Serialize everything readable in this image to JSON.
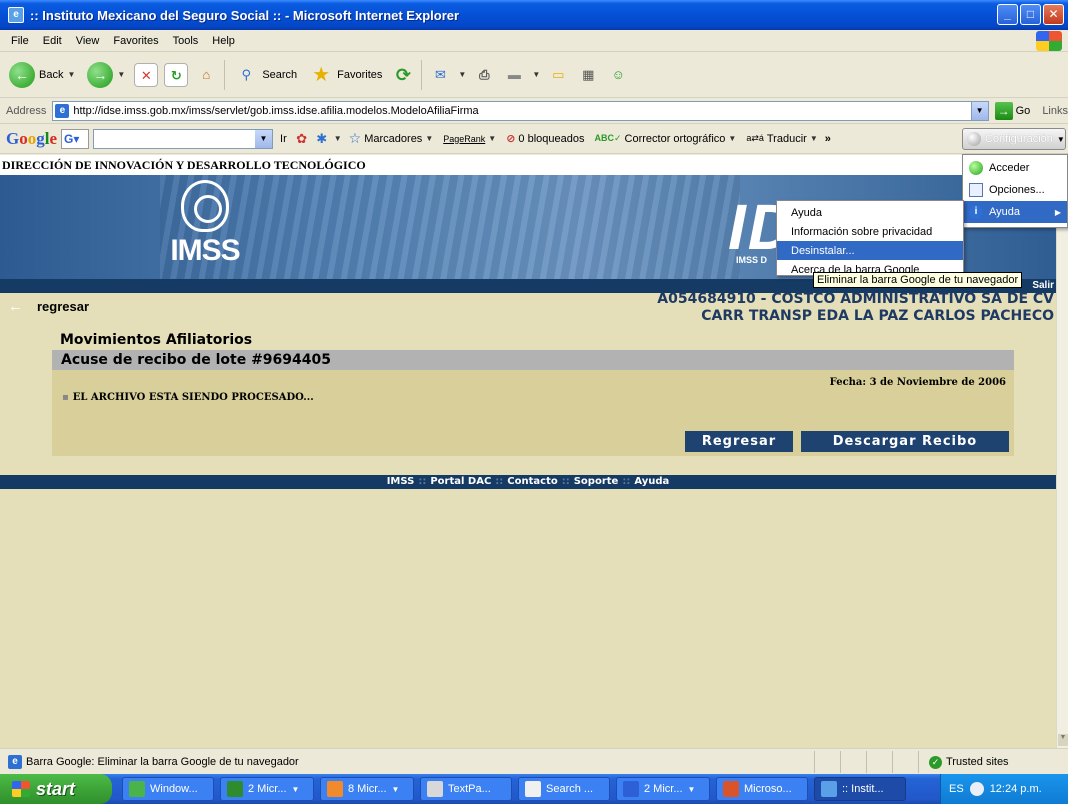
{
  "window": {
    "title": ":: Instituto Mexicano del Seguro Social :: - Microsoft Internet Explorer"
  },
  "menu": [
    "File",
    "Edit",
    "View",
    "Favorites",
    "Tools",
    "Help"
  ],
  "toolbar": {
    "back_label": "Back",
    "search_label": "Search",
    "favorites_label": "Favorites"
  },
  "address": {
    "label": "Address",
    "url": "http://idse.imss.gob.mx/imss/servlet/gob.imss.idse.afilia.modelos.ModeloAfiliaFirma",
    "go_label": "Go",
    "links_label": "Links"
  },
  "google_toolbar": {
    "logo": "Google",
    "ir_label": "Ir",
    "marcadores": "Marcadores",
    "pagerank": "PageRank",
    "bloqueados": "0 bloqueados",
    "corrector": "Corrector ortográfico",
    "traducir": "Traducir",
    "configuracion": "Configuración"
  },
  "google_menu": {
    "items": [
      "Acceder",
      "Opciones...",
      "Ayuda"
    ],
    "submenu": [
      "Ayuda",
      "Información sobre privacidad",
      "Desinstalar...",
      "Acerca de la barra Google"
    ],
    "tooltip": "Eliminar la barra Google de tu navegador"
  },
  "page": {
    "header": "DIRECCIÓN DE INNOVACIÓN Y DESARROLLO TECNOLÓGICO",
    "imss_logo_text": "IMSS",
    "idse_logo_text": "IDSE",
    "idse_sub": "IMSS D",
    "salir": "Salir",
    "back_link": "regresar",
    "company_line1": "A054684910 - COSTCO ADMINISTRATIVO SA DE CV",
    "company_line2": "CARR TRANSP EDA LA PAZ CARLOS PACHECO",
    "section_title": "Movimientos Afiliatorios",
    "box_title": "Acuse de recibo de lote #9694405",
    "fecha": "Fecha: 3 de Noviembre de 2006",
    "processing": "EL ARCHIVO ESTA SIENDO PROCESADO...",
    "regresar_btn": "Regresar",
    "descargar_btn": "Descargar Recibo",
    "footer_links": [
      "IMSS",
      "Portal DAC",
      "Contacto",
      "Soporte",
      "Ayuda"
    ]
  },
  "status": {
    "text": "Barra Google: Eliminar la barra Google de tu navegador",
    "zone": "Trusted sites"
  },
  "taskbar": {
    "start": "start",
    "tasks": [
      "Window...",
      "2 Micr...",
      "8 Micr...",
      "TextPa...",
      "Search ...",
      "2 Micr...",
      "Microso...",
      ":: Instit..."
    ],
    "lang": "ES",
    "clock": "12:24 p.m."
  }
}
